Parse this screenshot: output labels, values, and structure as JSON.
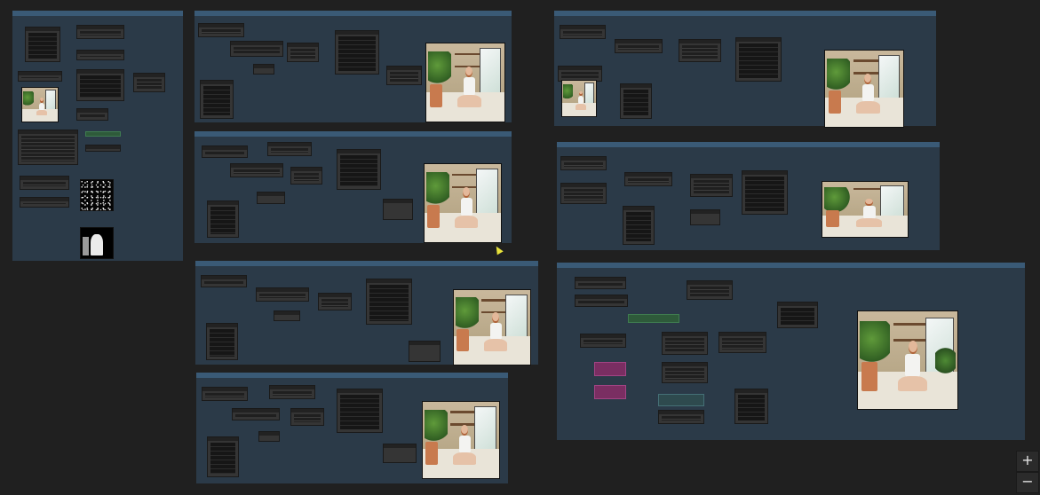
{
  "canvas": {
    "background": "#202020",
    "group_color": "#2b3a48",
    "group_header_color": "#3a5a76",
    "wire_colors": [
      "#8ec9e8",
      "#e8d27a",
      "#9bd08a",
      "#d07ab0"
    ]
  },
  "groups": [
    {
      "id": "g-loader",
      "title": ""
    },
    {
      "id": "g-top1",
      "title": ""
    },
    {
      "id": "g-mid1",
      "title": ""
    },
    {
      "id": "g-mid2",
      "title": ""
    },
    {
      "id": "g-bot1",
      "title": ""
    },
    {
      "id": "g-right1",
      "title": ""
    },
    {
      "id": "g-right2",
      "title": ""
    },
    {
      "id": "g-right3",
      "title": ""
    }
  ],
  "zoom_controls": {
    "zoom_in": "+",
    "zoom_out": "−"
  }
}
